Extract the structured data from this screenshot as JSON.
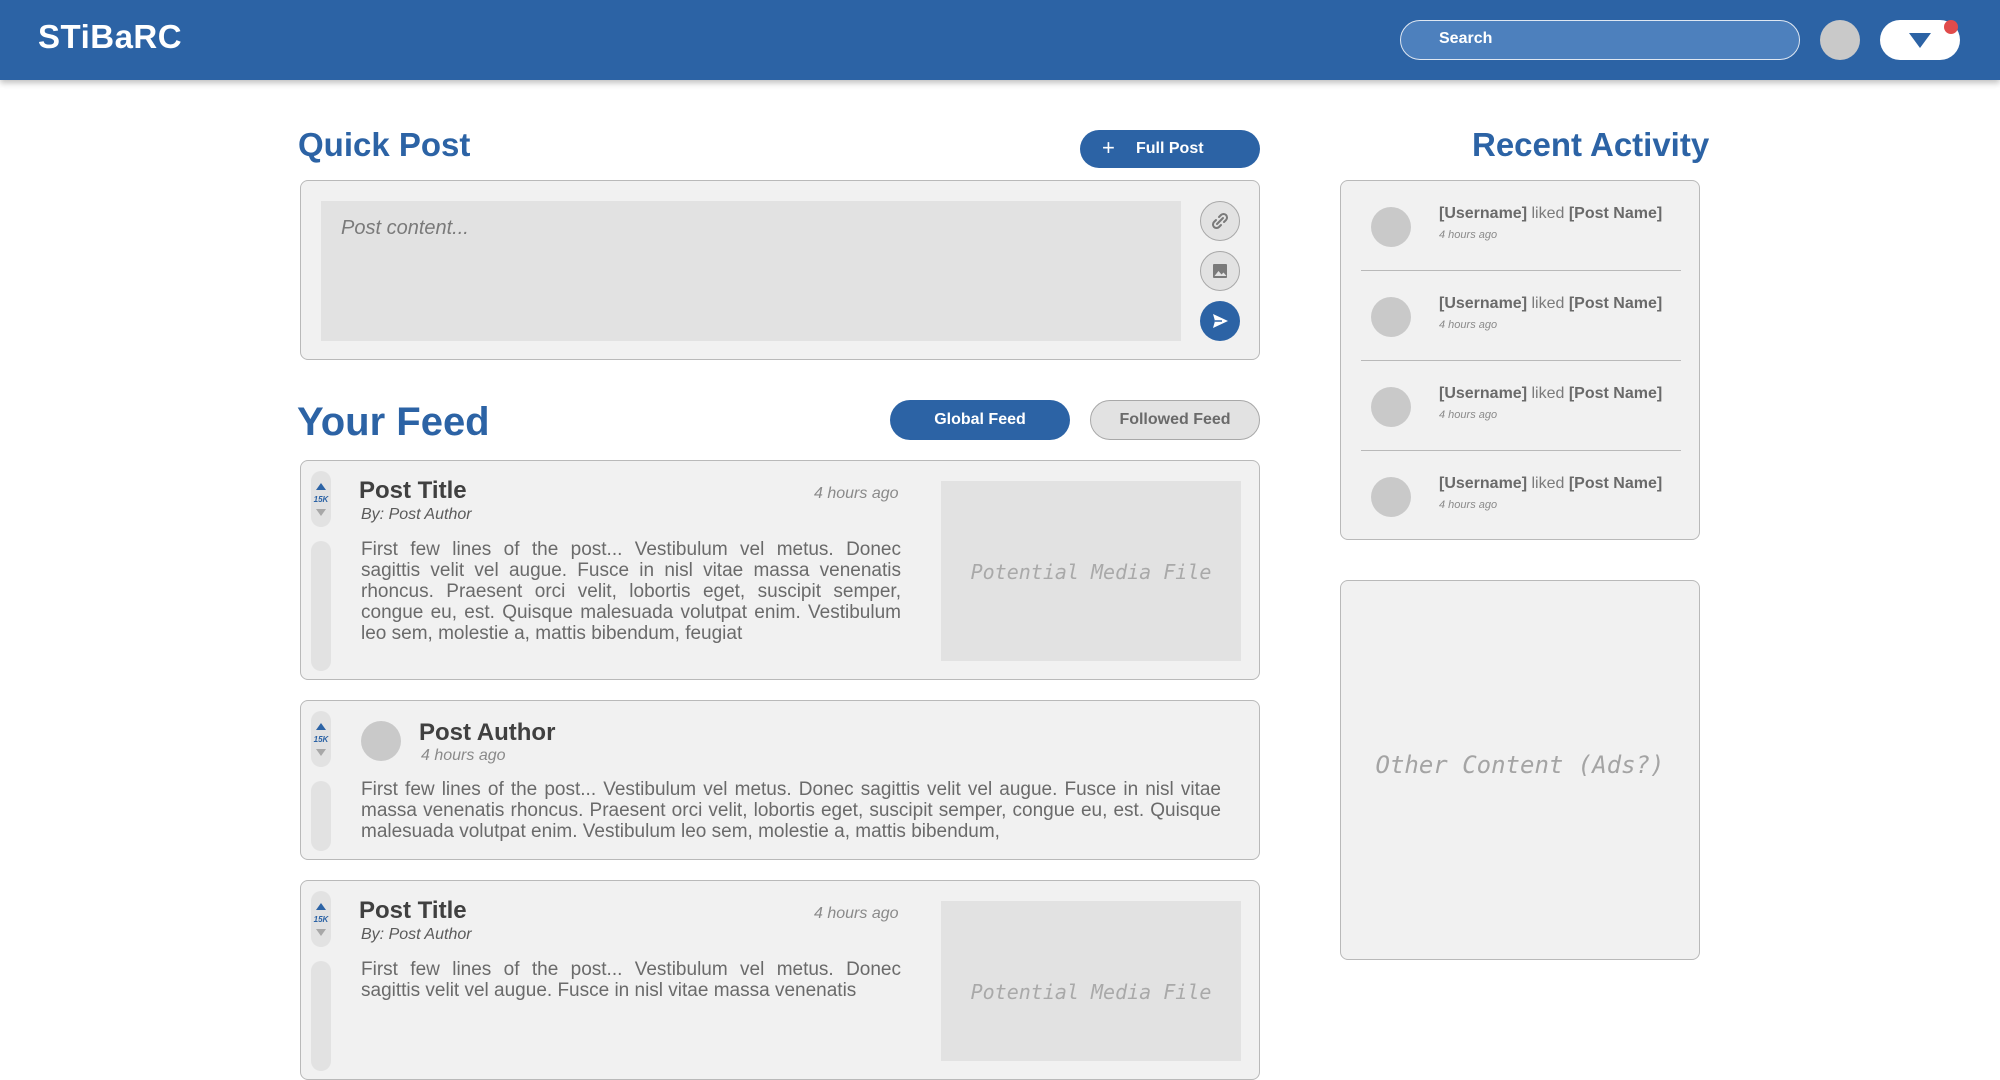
{
  "header": {
    "logo": "STiBaRC",
    "search_label": "Search",
    "colors": {
      "brand": "#2c63a5",
      "notification": "#e04b4b"
    }
  },
  "quick_post": {
    "title": "Quick Post",
    "full_post_icon": "plus-icon",
    "full_post_label": "Full Post",
    "placeholder": "Post content...",
    "tools": [
      "link-icon",
      "image-icon",
      "send-icon"
    ]
  },
  "feed": {
    "title": "Your Feed",
    "tabs": [
      {
        "label": "Global Feed",
        "active": true
      },
      {
        "label": "Followed Feed",
        "active": false
      }
    ],
    "posts": [
      {
        "votes": "15K",
        "title": "Post Title",
        "author": "By: Post Author",
        "time": "4 hours ago",
        "body": "First few lines of the post... Vestibulum vel metus. Donec sagittis velit vel augue. Fusce in nisl vitae massa venenatis rhoncus. Praesent orci velit, lobortis eget, suscipit semper, congue eu, est. Quisque malesuada volutpat enim. Vestibulum leo sem, molestie a, mattis bibendum, feugiat",
        "media": "Potential Media File"
      },
      {
        "votes": "15K",
        "author": "Post Author",
        "time": "4 hours ago",
        "body": "First few lines of the post... Vestibulum vel metus. Donec sagittis velit vel augue. Fusce in nisl vitae massa venenatis rhoncus. Praesent orci velit, lobortis eget, suscipit semper, congue eu, est. Quisque malesuada volutpat enim. Vestibulum leo sem, molestie a, mattis bibendum,"
      },
      {
        "votes": "15K",
        "title": "Post Title",
        "author": "By: Post Author",
        "time": "4 hours ago",
        "body": "First few lines of the post... Vestibulum vel metus. Donec sagittis velit vel augue. Fusce in nisl vitae massa venenatis",
        "media": "Potential Media File"
      }
    ]
  },
  "recent_activity": {
    "title": "Recent Activity",
    "items": [
      {
        "user": "[Username]",
        "verb": "liked",
        "target": "[Post Name]",
        "time": "4 hours ago"
      },
      {
        "user": "[Username]",
        "verb": "liked",
        "target": "[Post Name]",
        "time": "4 hours ago"
      },
      {
        "user": "[Username]",
        "verb": "liked",
        "target": "[Post Name]",
        "time": "4 hours ago"
      },
      {
        "user": "[Username]",
        "verb": "liked",
        "target": "[Post Name]",
        "time": "4 hours ago"
      }
    ]
  },
  "sidebar_ads": {
    "label": "Other Content (Ads?)"
  }
}
